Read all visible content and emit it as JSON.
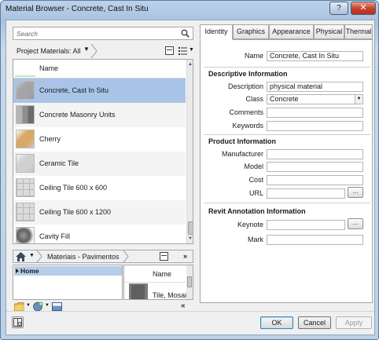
{
  "window": {
    "title": "Material Browser - Concrete, Cast In Situ",
    "help_glyph": "?",
    "close_glyph": "✕"
  },
  "search": {
    "placeholder": "Search"
  },
  "library_bar": {
    "label": "Project Materials: All",
    "dropdown_glyph": "▼"
  },
  "materials": {
    "column_header": "Name",
    "items": [
      {
        "label": "Concrete, Cast In Situ",
        "thumb": "gray-cube",
        "color": "#a5a5a5",
        "selected": true
      },
      {
        "label": "Concrete Masonry Units",
        "thumb": "masonry",
        "color": "#8e8e8e",
        "selected": false
      },
      {
        "label": "Cherry",
        "thumb": "wood-cube",
        "color": "#d8a868",
        "selected": false
      },
      {
        "label": "Ceramic Tile",
        "thumb": "white-cube",
        "color": "#d0d0d0",
        "selected": false
      },
      {
        "label": "Ceiling Tile 600 x 600",
        "thumb": "grid-tile",
        "color": "#dcdcdc",
        "selected": false
      },
      {
        "label": "Ceiling Tile 600 x 1200",
        "thumb": "grid-tile",
        "color": "#dcdcdc",
        "selected": false
      },
      {
        "label": "Cavity Fill",
        "thumb": "dark-blob",
        "color": "#606060",
        "selected": false
      }
    ]
  },
  "library_nav": {
    "label": "Materiais - Pavimentos",
    "more_glyph": "»",
    "dropdown_glyph": "▼"
  },
  "library_tree": {
    "home_label": "Home"
  },
  "library_grid": {
    "column_header": "Name",
    "item_label": "Tile, Mosaic,"
  },
  "bottom_tools": {
    "caret": "▼",
    "collapse_glyph": "«"
  },
  "tabs": [
    {
      "label": "Identity",
      "active": true
    },
    {
      "label": "Graphics",
      "active": false
    },
    {
      "label": "Appearance",
      "active": false
    },
    {
      "label": "Physical",
      "active": false
    },
    {
      "label": "Thermal",
      "active": false
    }
  ],
  "identity": {
    "name_label": "Name",
    "name_value": "Concrete, Cast In Situ",
    "descriptive": {
      "heading": "Descriptive Information",
      "description_label": "Description",
      "description_value": "physical material",
      "class_label": "Class",
      "class_value": "Concrete",
      "class_dropdown_glyph": "▼",
      "comments_label": "Comments",
      "comments_value": "",
      "keywords_label": "Keywords",
      "keywords_value": ""
    },
    "product": {
      "heading": "Product Information",
      "manufacturer_label": "Manufacturer",
      "manufacturer_value": "",
      "model_label": "Model",
      "model_value": "",
      "cost_label": "Cost",
      "cost_value": "",
      "url_label": "URL",
      "url_value": "",
      "browse_label": "..."
    },
    "annotation": {
      "heading": "Revit Annotation Information",
      "keynote_label": "Keynote",
      "keynote_value": "",
      "mark_label": "Mark",
      "mark_value": "",
      "browse_label": "..."
    }
  },
  "buttons": {
    "ok": "OK",
    "cancel": "Cancel",
    "apply": "Apply"
  },
  "colors": {
    "selection": "#a9c4e7",
    "window_frame": "#a9c2df",
    "close_red": "#c5422b"
  }
}
